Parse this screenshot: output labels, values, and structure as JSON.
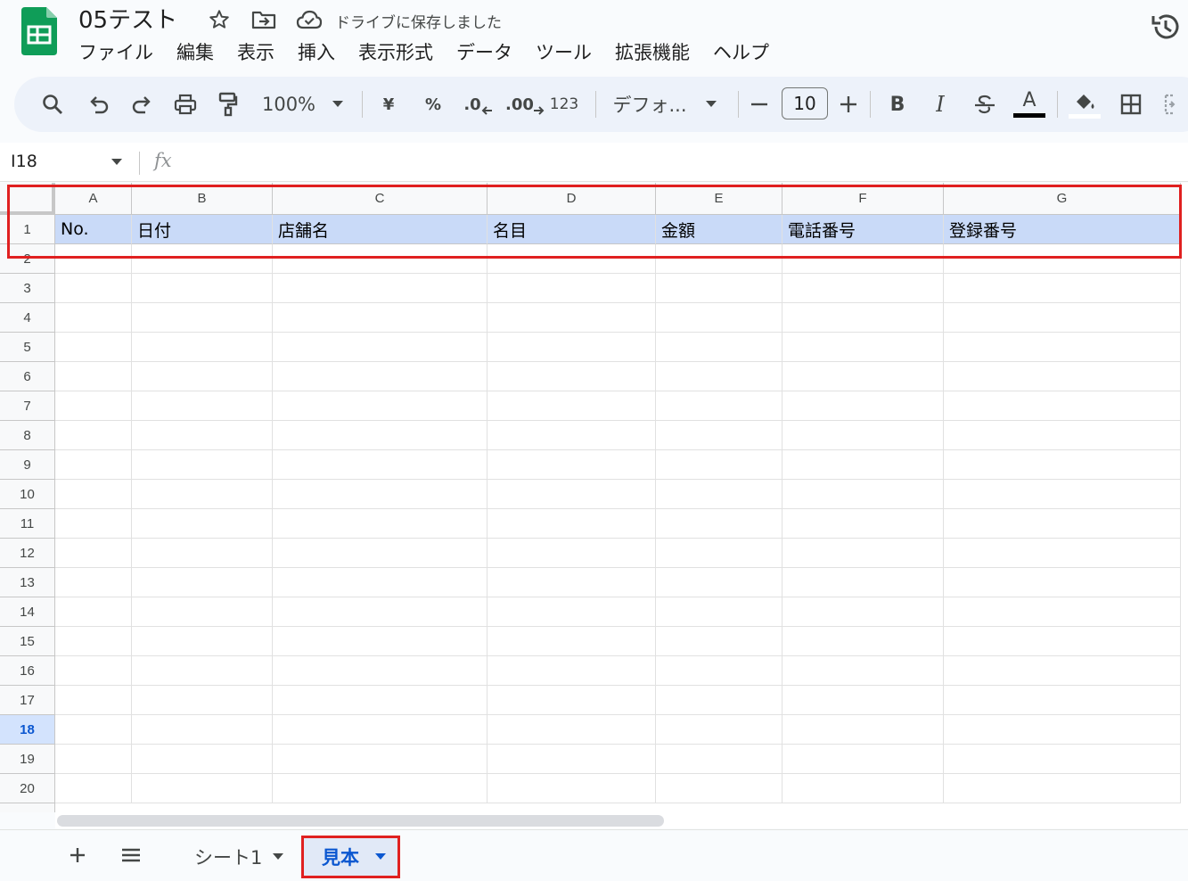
{
  "header": {
    "title": "05テスト",
    "save_status": "ドライブに保存しました"
  },
  "menu": [
    "ファイル",
    "編集",
    "表示",
    "挿入",
    "表示形式",
    "データ",
    "ツール",
    "拡張機能",
    "ヘルプ"
  ],
  "toolbar": {
    "zoom": "100%",
    "currency": "¥",
    "percent": "%",
    "decrease_decimal": ".0",
    "increase_decimal": ".00",
    "number_format": "123",
    "font": "デフォ...",
    "font_size": "10",
    "bold": "B",
    "italic": "I",
    "text_color_letter": "A"
  },
  "formula_bar": {
    "name_box": "I18",
    "fx": "fx"
  },
  "grid": {
    "columns": [
      "A",
      "B",
      "C",
      "D",
      "E",
      "F",
      "G"
    ],
    "rows": [
      "1",
      "2",
      "3",
      "4",
      "5",
      "6",
      "7",
      "8",
      "9",
      "10",
      "11",
      "12",
      "13",
      "14",
      "15",
      "16",
      "17",
      "18",
      "19",
      "20"
    ],
    "active_row": "18",
    "header_row": [
      "No.",
      "日付",
      "店舗名",
      "名目",
      "金額",
      "電話番号",
      "登録番号"
    ],
    "header_fill": "#c9daf8"
  },
  "sheets": {
    "tabs": [
      "シート1",
      "見本"
    ],
    "active": "見本"
  },
  "colors": {
    "accent": "#0b57d0",
    "highlight_border": "#e02020",
    "logo_green": "#0f9d58"
  }
}
